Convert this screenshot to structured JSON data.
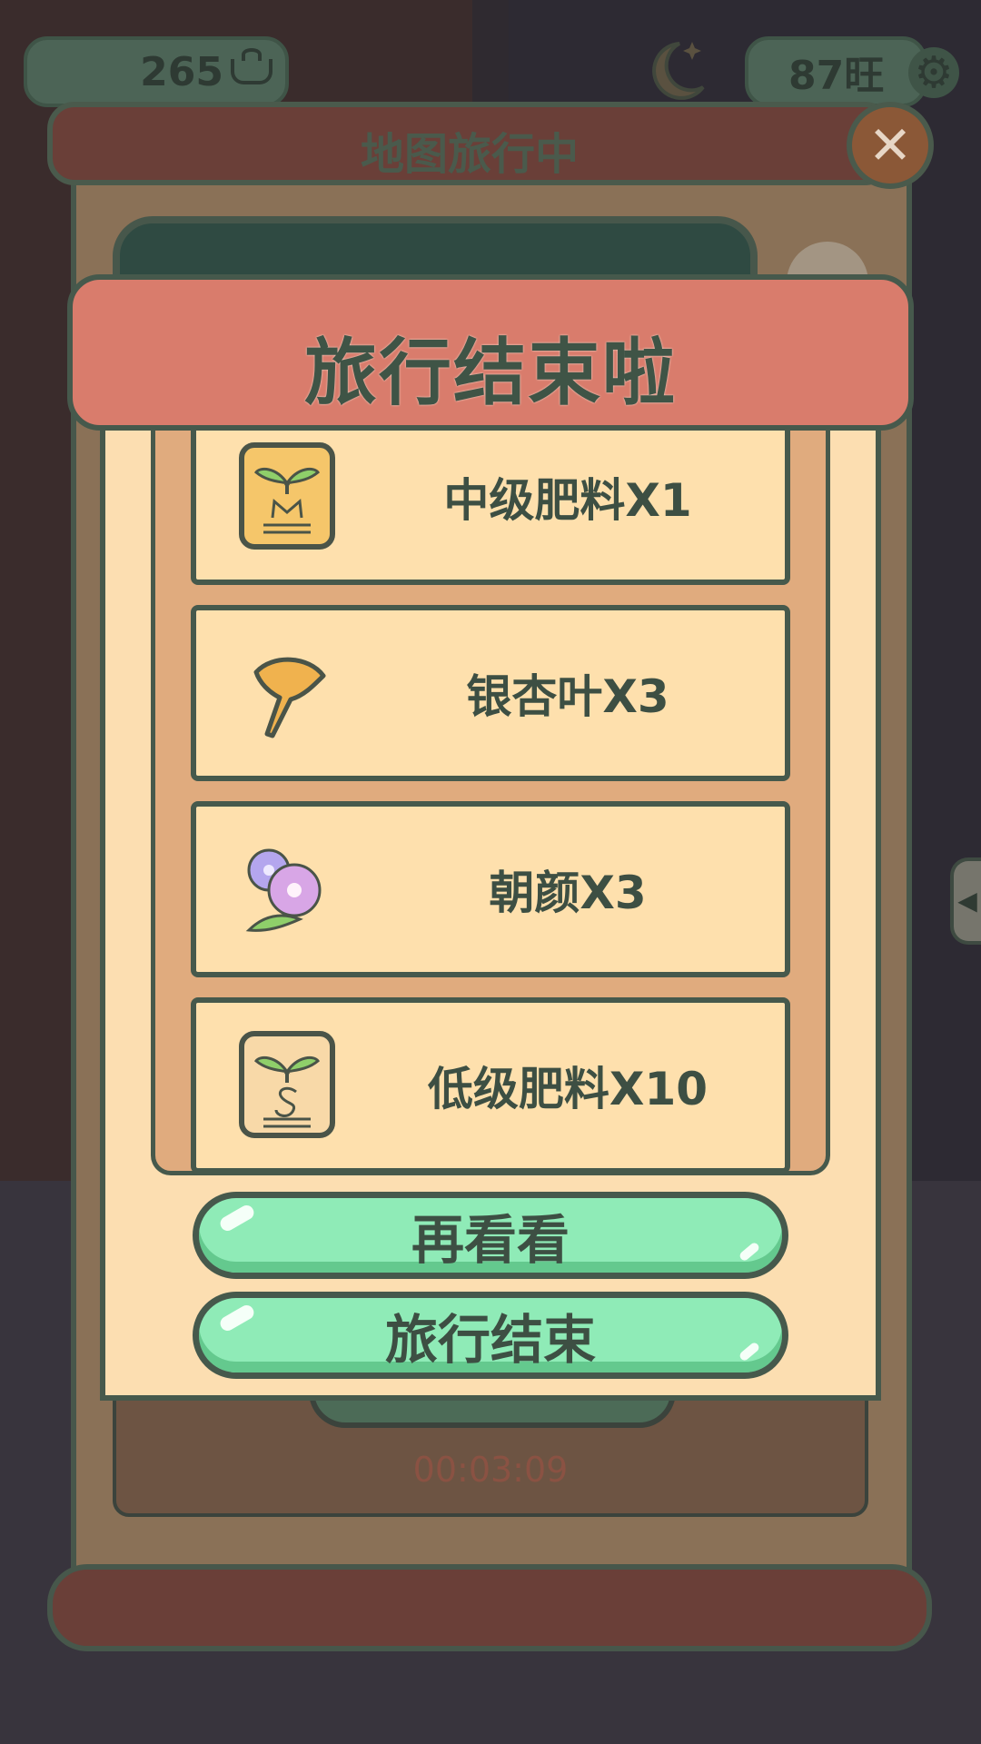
{
  "hud": {
    "coins": "265",
    "wang": "87旺"
  },
  "screen": {
    "title": "地图旅行中",
    "timer": "00:03:09"
  },
  "modal": {
    "title": "旅行结束啦",
    "rewards": [
      {
        "icon": "fertilizer-m-icon",
        "label": "中级肥料X1"
      },
      {
        "icon": "ginkgo-leaf-icon",
        "label": "银杏叶X3"
      },
      {
        "icon": "morning-glory-icon",
        "label": "朝颜X3"
      },
      {
        "icon": "fertilizer-s-icon",
        "label": "低级肥料X10"
      }
    ],
    "buttons": {
      "look_again": "再看看",
      "end_trip": "旅行结束"
    }
  },
  "colors": {
    "banner": "#d97c6c",
    "panel": "#fcdeb1",
    "button": "#8febb7",
    "outline": "#46594c"
  }
}
